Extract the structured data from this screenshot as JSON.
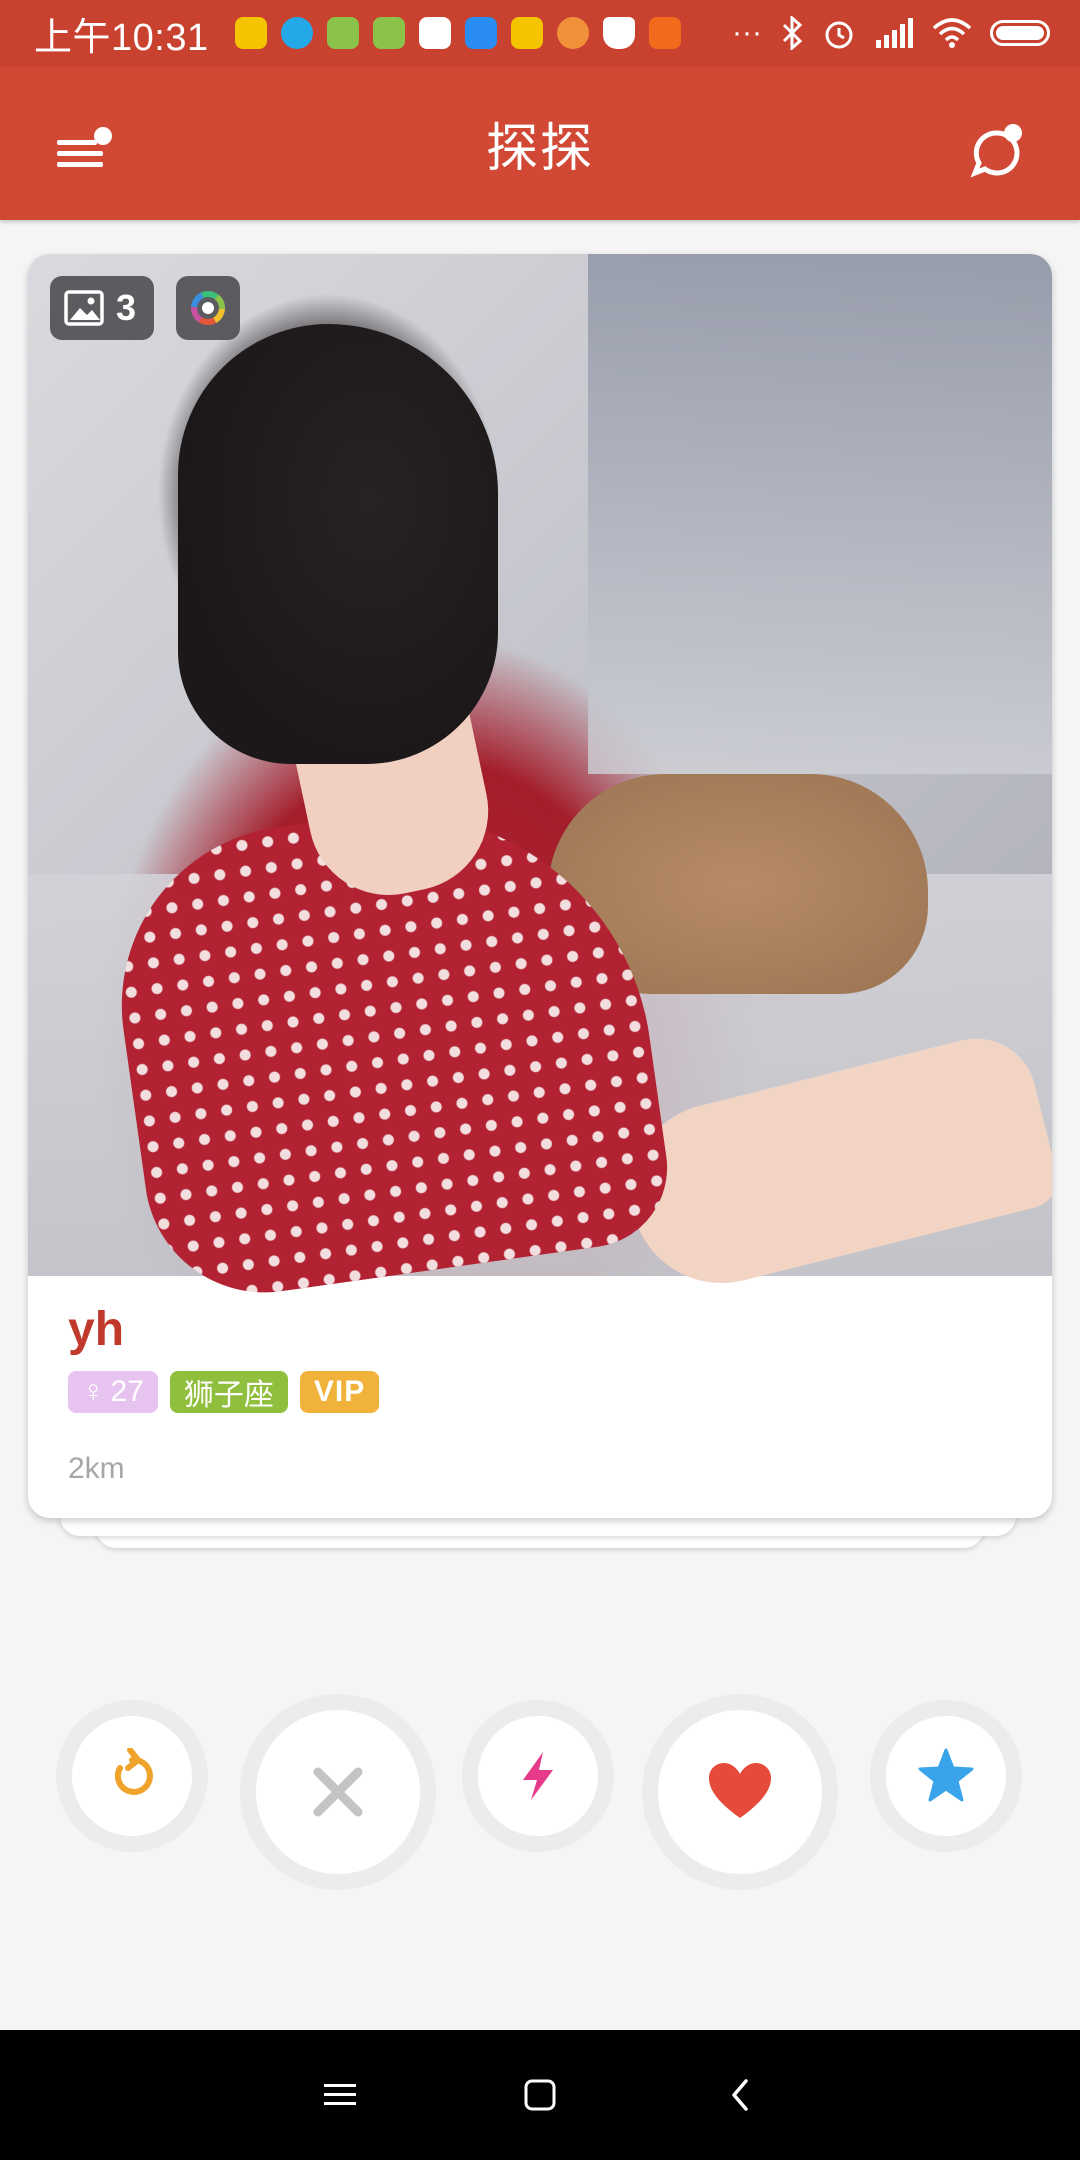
{
  "status_bar": {
    "time": "上午10:31",
    "signal_text": "···"
  },
  "app_bar": {
    "title": "探探"
  },
  "card": {
    "photo_count": "3",
    "name": "yh",
    "age": "27",
    "zodiac": "狮子座",
    "vip": "VIP",
    "distance": "2km"
  },
  "icons": {
    "menu": "menu-icon",
    "chat": "chat-icon",
    "gallery": "gallery-icon",
    "filter": "color-wheel-icon",
    "undo": "undo-icon",
    "nope": "close-icon",
    "boost": "lightning-icon",
    "like": "heart-icon",
    "super_like": "star-icon"
  },
  "colors": {
    "app_bar": "#d14834",
    "status_bar": "#c9412f",
    "name": "#c0392b",
    "age_tag": "#e7c4f0",
    "zodiac_tag": "#8fbf3c",
    "vip_tag": "#f0b23a",
    "undo": "#f0a32a",
    "boost": "#e63a8a",
    "like": "#e64a3a",
    "super_like": "#3aa4ea"
  }
}
